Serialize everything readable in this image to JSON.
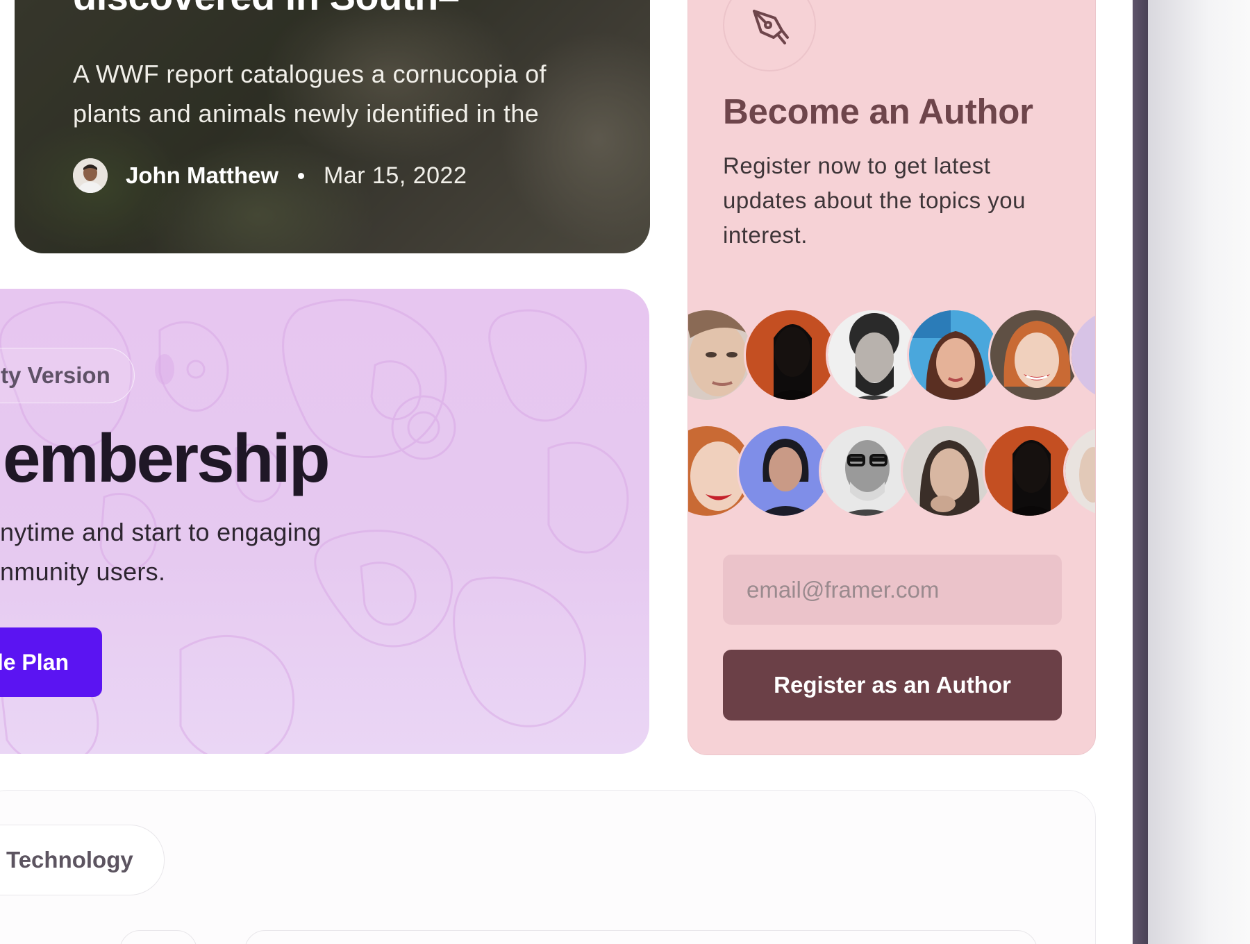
{
  "article": {
    "title": "discovered in South–",
    "excerpt": "A WWF report catalogues a cornucopia of plants and animals newly identified in the",
    "author": "John Matthew",
    "date": "Mar 15, 2022"
  },
  "membership": {
    "badge": "ty Version",
    "title": "embership",
    "description": "nytime and start to engaging nmunity users.",
    "button": "le Plan"
  },
  "author_panel": {
    "icon": "pen-tool-icon",
    "heading": "Become an Author",
    "text": "Register now to get latest updates about the topics you interest.",
    "email_placeholder": "email@framer.com",
    "button": "Register as an Author"
  },
  "bottom": {
    "category": "Technology"
  },
  "colors": {
    "membership_button": "#5b14f2",
    "author_card_bg": "#f6d2d6",
    "author_button": "#6b4047",
    "author_heading": "#6e454b"
  }
}
